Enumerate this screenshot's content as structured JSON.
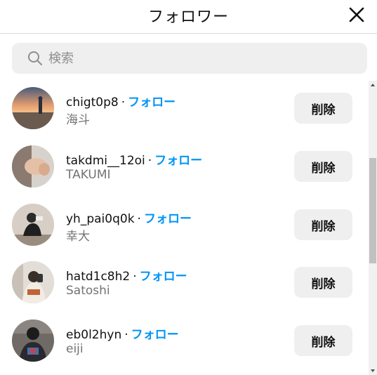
{
  "dialog": {
    "title": "フォロワー",
    "close_icon": "close-icon"
  },
  "search": {
    "placeholder": "検索",
    "value": "",
    "icon": "search-icon"
  },
  "separator": "·",
  "follow_label": "フォロー",
  "remove_label": "削除",
  "followers": [
    {
      "username": "chigt0p8",
      "fullname": "海斗",
      "avatar": "avatar-beach-sunset"
    },
    {
      "username": "takdmi__12oi",
      "fullname": "TAKUMI",
      "avatar": "avatar-hand-closeup"
    },
    {
      "username": "yh_pai0q0k",
      "fullname": "幸大",
      "avatar": "avatar-person-sitting"
    },
    {
      "username": "hatd1c8h2",
      "fullname": "Satoshi",
      "avatar": "avatar-mirror-selfie"
    },
    {
      "username": "eb0l2hyn",
      "fullname": "eiji",
      "avatar": "avatar-dark-shirt"
    }
  ],
  "colors": {
    "link": "#0095f6",
    "button_bg": "#efefef",
    "secondary_text": "#737373"
  }
}
